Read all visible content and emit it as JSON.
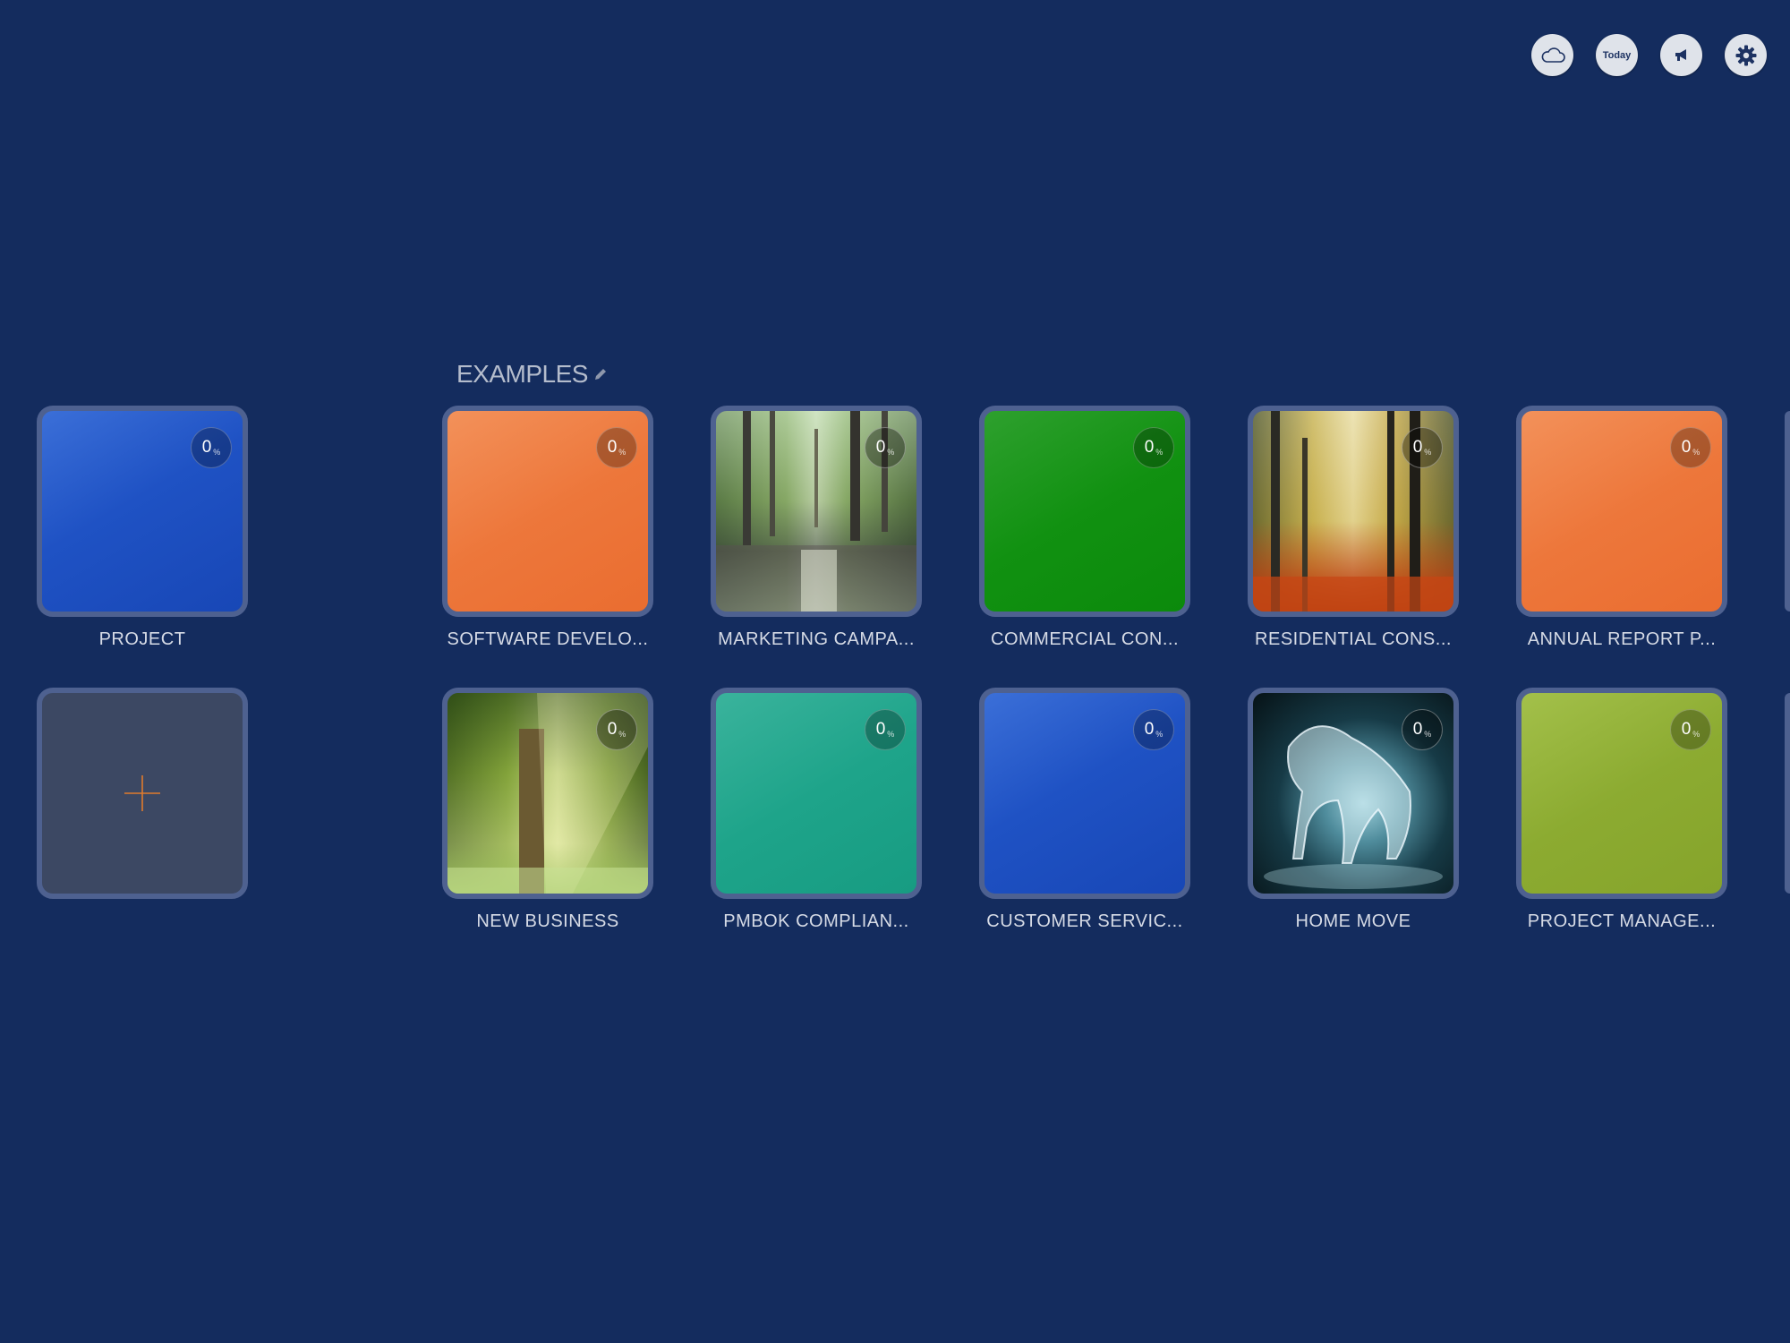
{
  "toolbar": {
    "cloud": "cloud-icon",
    "today_label": "Today",
    "announce": "megaphone-icon",
    "settings": "gear-icon"
  },
  "section": {
    "title": "EXAMPLES"
  },
  "project_tile": {
    "label": "PROJECT",
    "progress": "0",
    "unit": "%"
  },
  "add_tile": {
    "icon": "plus-icon"
  },
  "examples": [
    {
      "label": "SOFTWARE DEVELO...",
      "progress": "0",
      "unit": "%"
    },
    {
      "label": "MARKETING CAMPA...",
      "progress": "0",
      "unit": "%"
    },
    {
      "label": "COMMERCIAL CON...",
      "progress": "0",
      "unit": "%"
    },
    {
      "label": "RESIDENTIAL CONS...",
      "progress": "0",
      "unit": "%"
    },
    {
      "label": "ANNUAL REPORT P...",
      "progress": "0",
      "unit": "%"
    },
    {
      "label": "NEW BUSINESS",
      "progress": "0",
      "unit": "%"
    },
    {
      "label": "PMBOK COMPLIAN...",
      "progress": "0",
      "unit": "%"
    },
    {
      "label": "CUSTOMER SERVIC...",
      "progress": "0",
      "unit": "%"
    },
    {
      "label": "HOME MOVE",
      "progress": "0",
      "unit": "%"
    },
    {
      "label": "PROJECT MANAGE...",
      "progress": "0",
      "unit": "%"
    }
  ],
  "colors": {
    "background": "#142c5e",
    "blue": "#1f52c4",
    "orange": "#ed773b",
    "green": "#119111",
    "teal": "#1ea48a",
    "lime": "#8cab31",
    "accent_plus": "#e07a2c"
  }
}
